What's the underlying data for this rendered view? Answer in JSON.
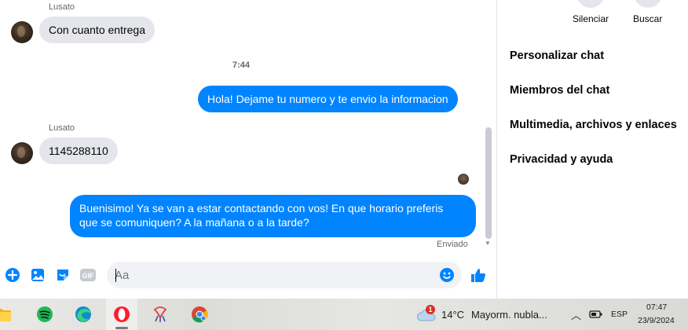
{
  "chat": {
    "messages": [
      {
        "sender": "Lusato",
        "text": "Con cuanto entrega"
      },
      {
        "timestamp": "7:44"
      },
      {
        "text": "Hola! Dejame tu numero y te envio la informacion"
      },
      {
        "sender": "Lusato",
        "text": "1145288110"
      },
      {
        "text_line1": "Buenisimo! Ya se van a estar contactando con vos! En que horario preferis",
        "text_line2": "que se comuniquen? A la mañana o a la tarde?"
      }
    ],
    "status": "Enviado"
  },
  "composer": {
    "placeholder": "Aa",
    "icons": [
      "plus-circle-icon",
      "photo-icon",
      "sticker-icon",
      "gif-icon",
      "emoji-icon",
      "thumbs-up-icon"
    ],
    "gif_label": "GIF"
  },
  "panel": {
    "actions": [
      {
        "label": "Silenciar",
        "icon": "bell-icon"
      },
      {
        "label": "Buscar",
        "icon": "search-icon"
      }
    ],
    "menu": [
      {
        "label": "Personalizar chat"
      },
      {
        "label": "Miembros del chat"
      },
      {
        "label": "Multimedia, archivos y enlaces"
      },
      {
        "label": "Privacidad y ayuda"
      }
    ]
  },
  "taskbar": {
    "apps": [
      "file-explorer-icon",
      "spotify-icon",
      "edge-icon",
      "opera-icon",
      "app-icon",
      "chrome-icon"
    ],
    "weather": {
      "temp": "14°C",
      "desc": "Mayorm. nubla...",
      "badge": "1"
    },
    "language": "ESP",
    "time": "07:47",
    "date": "23/9/2024"
  },
  "colors": {
    "accent": "#0084ff",
    "incoming": "#e4e6eb"
  }
}
